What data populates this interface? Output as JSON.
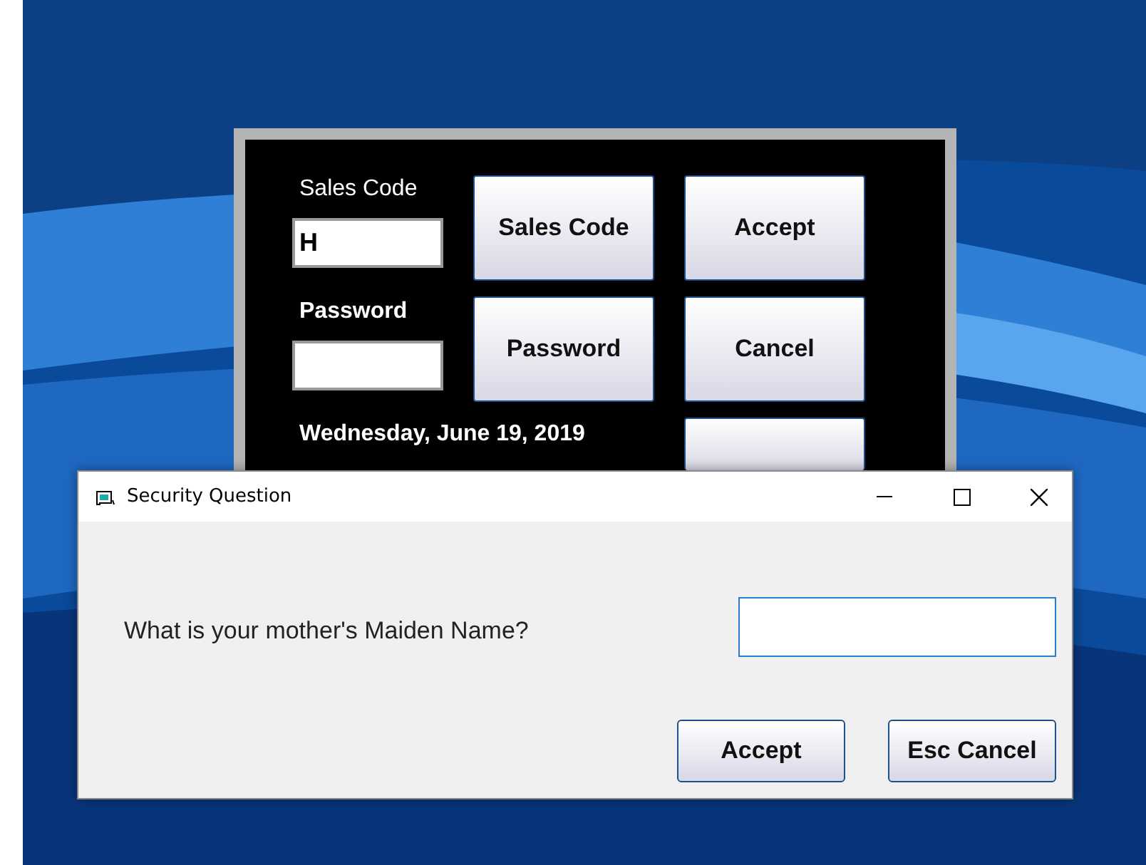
{
  "main_window": {
    "sales_code_label": "Sales Code",
    "sales_code_value": "H",
    "password_label": "Password",
    "date": "Wednesday, June 19, 2019",
    "middle_buttons": [
      "Sales Code",
      "Password"
    ],
    "right_buttons": [
      "Accept",
      "Cancel"
    ]
  },
  "dialog": {
    "title": "Security Question",
    "question": "What is your mother's Maiden Name?",
    "buttons": [
      "Accept",
      "Esc Cancel"
    ]
  }
}
